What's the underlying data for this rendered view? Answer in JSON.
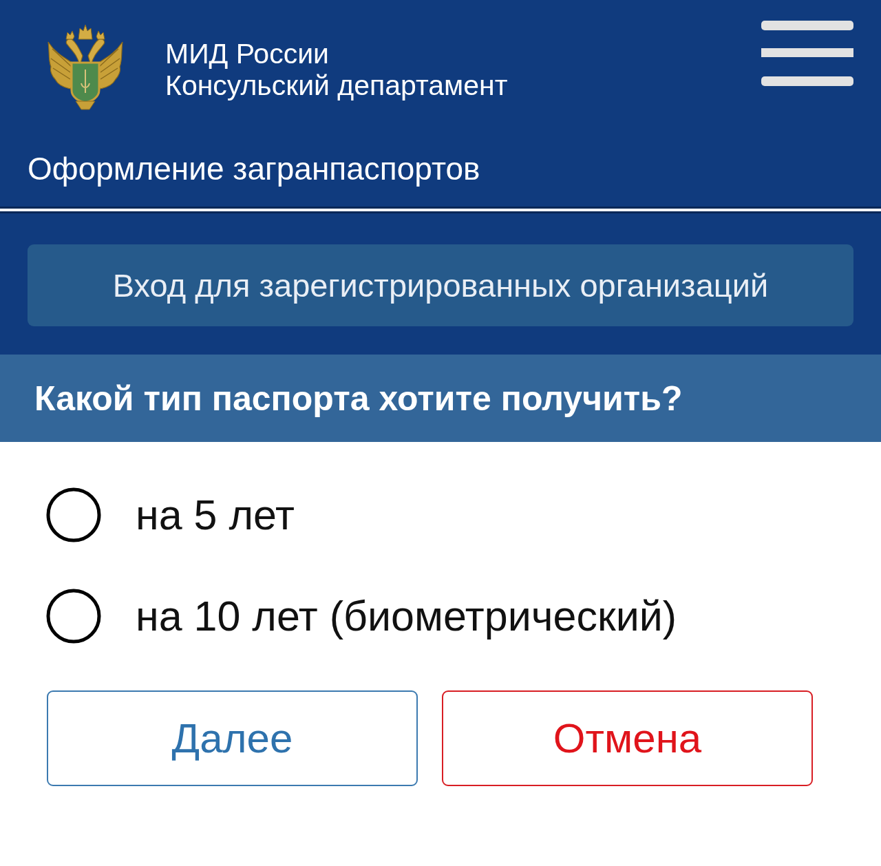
{
  "header": {
    "org_name": "МИД России",
    "department": "Консульский департамент",
    "section_title": "Оформление загранпаспортов"
  },
  "login_button": {
    "label": "Вход для зарегистрированных организаций"
  },
  "question": "Какой тип паспорта хотите получить?",
  "options": [
    {
      "label": "на 5 лет",
      "selected": false
    },
    {
      "label": "на 10 лет (биометрический)",
      "selected": false
    }
  ],
  "buttons": [
    {
      "label": "Далее",
      "kind": "next"
    },
    {
      "label": "Отмена",
      "kind": "cancel"
    }
  ]
}
